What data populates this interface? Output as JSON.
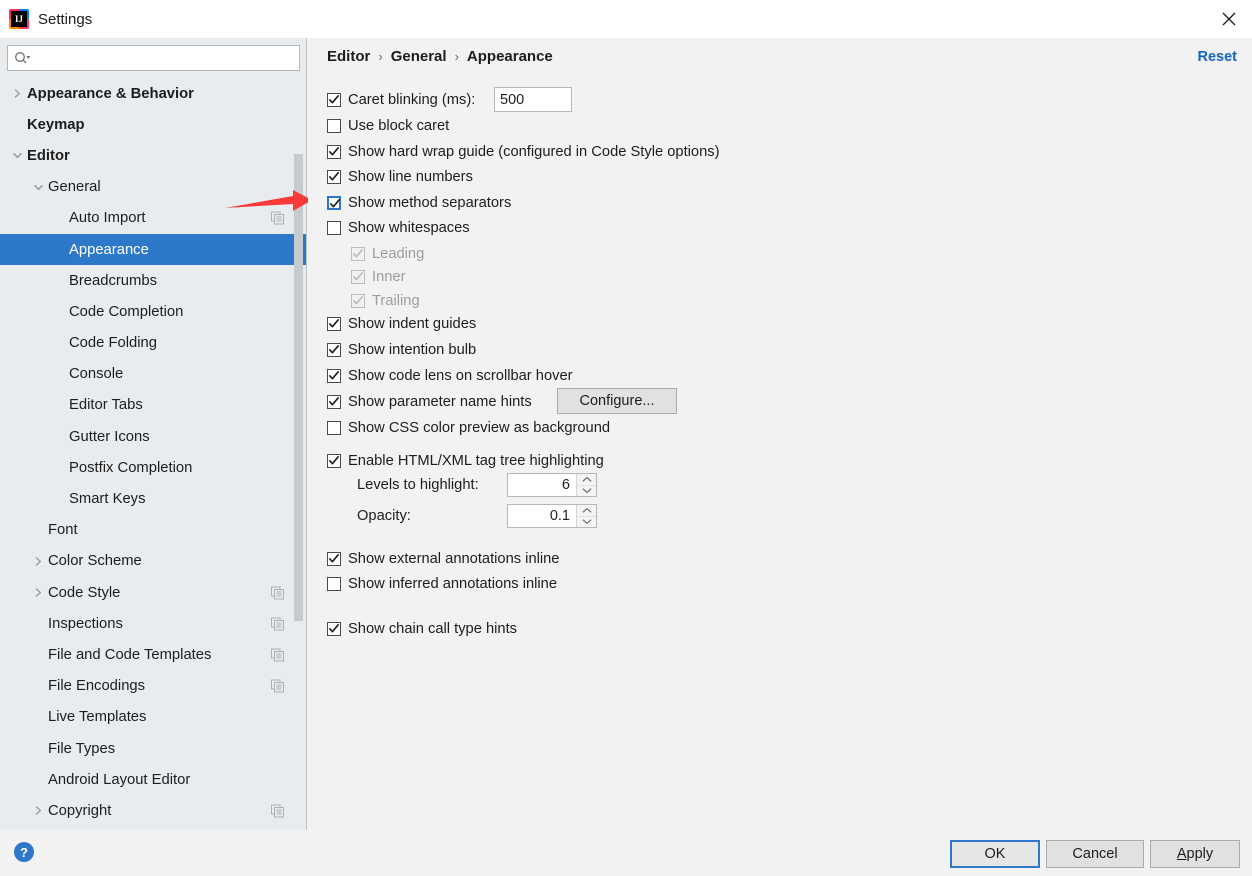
{
  "window": {
    "title": "Settings",
    "logo_icon": "intellij-idea-logo",
    "close_icon": "close-icon"
  },
  "sidebar": {
    "search": {
      "placeholder": "",
      "value": "",
      "icon": "search-icon"
    },
    "items": [
      {
        "label": "Appearance & Behavior",
        "indent": 0,
        "arrow": "collapsed",
        "bold": true,
        "selected": false,
        "copy": false
      },
      {
        "label": "Keymap",
        "indent": 0,
        "arrow": "none",
        "bold": true,
        "selected": false,
        "copy": false
      },
      {
        "label": "Editor",
        "indent": 0,
        "arrow": "expanded",
        "bold": true,
        "selected": false,
        "copy": false
      },
      {
        "label": "General",
        "indent": 1,
        "arrow": "expanded",
        "bold": false,
        "selected": false,
        "copy": false
      },
      {
        "label": "Auto Import",
        "indent": 2,
        "arrow": "none",
        "bold": false,
        "selected": false,
        "copy": true
      },
      {
        "label": "Appearance",
        "indent": 2,
        "arrow": "none",
        "bold": false,
        "selected": true,
        "copy": false
      },
      {
        "label": "Breadcrumbs",
        "indent": 2,
        "arrow": "none",
        "bold": false,
        "selected": false,
        "copy": false
      },
      {
        "label": "Code Completion",
        "indent": 2,
        "arrow": "none",
        "bold": false,
        "selected": false,
        "copy": false
      },
      {
        "label": "Code Folding",
        "indent": 2,
        "arrow": "none",
        "bold": false,
        "selected": false,
        "copy": false
      },
      {
        "label": "Console",
        "indent": 2,
        "arrow": "none",
        "bold": false,
        "selected": false,
        "copy": false
      },
      {
        "label": "Editor Tabs",
        "indent": 2,
        "arrow": "none",
        "bold": false,
        "selected": false,
        "copy": false
      },
      {
        "label": "Gutter Icons",
        "indent": 2,
        "arrow": "none",
        "bold": false,
        "selected": false,
        "copy": false
      },
      {
        "label": "Postfix Completion",
        "indent": 2,
        "arrow": "none",
        "bold": false,
        "selected": false,
        "copy": false
      },
      {
        "label": "Smart Keys",
        "indent": 2,
        "arrow": "none",
        "bold": false,
        "selected": false,
        "copy": false
      },
      {
        "label": "Font",
        "indent": 1,
        "arrow": "none",
        "bold": false,
        "selected": false,
        "copy": false
      },
      {
        "label": "Color Scheme",
        "indent": 1,
        "arrow": "collapsed",
        "bold": false,
        "selected": false,
        "copy": false
      },
      {
        "label": "Code Style",
        "indent": 1,
        "arrow": "collapsed",
        "bold": false,
        "selected": false,
        "copy": true
      },
      {
        "label": "Inspections",
        "indent": 1,
        "arrow": "none",
        "bold": false,
        "selected": false,
        "copy": true
      },
      {
        "label": "File and Code Templates",
        "indent": 1,
        "arrow": "none",
        "bold": false,
        "selected": false,
        "copy": true
      },
      {
        "label": "File Encodings",
        "indent": 1,
        "arrow": "none",
        "bold": false,
        "selected": false,
        "copy": true
      },
      {
        "label": "Live Templates",
        "indent": 1,
        "arrow": "none",
        "bold": false,
        "selected": false,
        "copy": false
      },
      {
        "label": "File Types",
        "indent": 1,
        "arrow": "none",
        "bold": false,
        "selected": false,
        "copy": false
      },
      {
        "label": "Android Layout Editor",
        "indent": 1,
        "arrow": "none",
        "bold": false,
        "selected": false,
        "copy": false
      },
      {
        "label": "Copyright",
        "indent": 1,
        "arrow": "collapsed",
        "bold": false,
        "selected": false,
        "copy": true
      }
    ]
  },
  "main": {
    "breadcrumb": {
      "part1": "Editor",
      "part2": "General",
      "part3": "Appearance",
      "separator": "›"
    },
    "reset_label": "Reset",
    "caret_blinking": {
      "label": "Caret blinking (ms):",
      "value": "500",
      "checked": true
    },
    "options": [
      {
        "label": "Use block caret",
        "checked": false,
        "disabled": false,
        "focused": false
      },
      {
        "label": "Show hard wrap guide (configured in Code Style options)",
        "checked": true,
        "disabled": false,
        "focused": false
      },
      {
        "label": "Show line numbers",
        "checked": true,
        "disabled": false,
        "focused": false
      },
      {
        "label": "Show method separators",
        "checked": true,
        "disabled": false,
        "focused": true
      },
      {
        "label": "Show whitespaces",
        "checked": false,
        "disabled": false,
        "focused": false
      }
    ],
    "whitespace_sub": [
      {
        "label": "Leading",
        "checked": true,
        "disabled": true
      },
      {
        "label": "Inner",
        "checked": true,
        "disabled": true
      },
      {
        "label": "Trailing",
        "checked": true,
        "disabled": true
      }
    ],
    "options2": [
      {
        "label": "Show indent guides",
        "checked": true,
        "disabled": false,
        "focused": false
      },
      {
        "label": "Show intention bulb",
        "checked": true,
        "disabled": false,
        "focused": false
      },
      {
        "label": "Show code lens on scrollbar hover",
        "checked": true,
        "disabled": false,
        "focused": false
      }
    ],
    "param_hints": {
      "label": "Show parameter name hints",
      "checked": true,
      "button": "Configure..."
    },
    "css_preview": {
      "label": "Show CSS color preview as background",
      "checked": false
    },
    "tag_tree": {
      "label": "Enable HTML/XML tag tree highlighting",
      "checked": true,
      "levels_label": "Levels to highlight:",
      "levels_value": "6",
      "opacity_label": "Opacity:",
      "opacity_value": "0.1"
    },
    "annotations": [
      {
        "label": "Show external annotations inline",
        "checked": true
      },
      {
        "label": "Show inferred annotations inline",
        "checked": false
      }
    ],
    "chain_hints": {
      "label": "Show chain call type hints",
      "checked": true
    }
  },
  "footer": {
    "help_icon": "help-icon",
    "help_label": "?",
    "ok_label": "OK",
    "cancel_label": "Cancel",
    "apply_mnemonic": "A",
    "apply_rest": "pply"
  },
  "annotation": {
    "arrow_icon": "red-arrow-pointer",
    "color": "#f93a38"
  },
  "colors": {
    "selection": "#2d78c8",
    "sidebar_bg": "#e8ecef",
    "panel_bg": "#f2f2f2",
    "link": "#1266bf",
    "accent_red": "#f93a38"
  }
}
